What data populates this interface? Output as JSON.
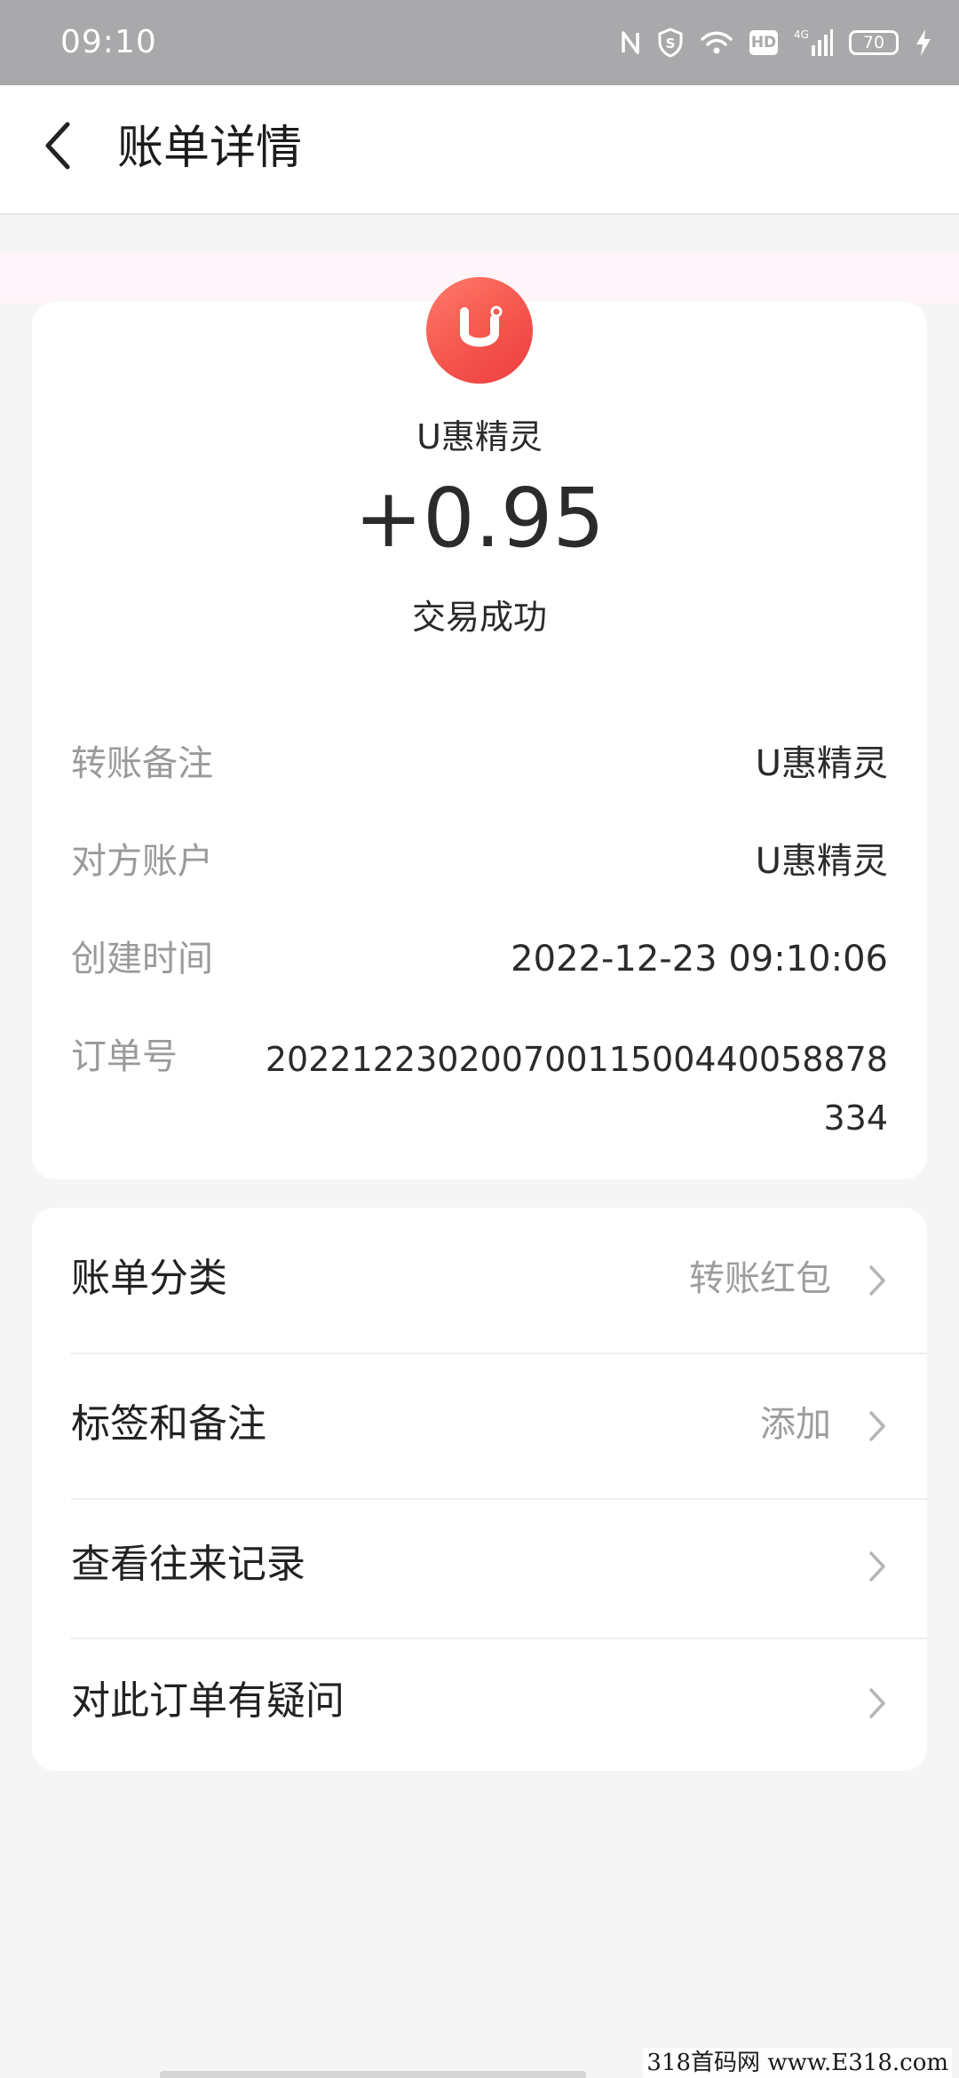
{
  "status_bar": {
    "time": "09:10",
    "icons": [
      "nfc-icon",
      "shield-icon",
      "wifi-icon",
      "hd-icon",
      "signal-4g-icon",
      "battery-icon",
      "charging-icon"
    ],
    "hd_label": "HD",
    "network_label": "4G",
    "battery_level": "70"
  },
  "header": {
    "back_icon": "chevron-left-icon",
    "title": "账单详情"
  },
  "transaction": {
    "logo_icon": "u-logo-icon",
    "merchant": "U惠精灵",
    "amount": "+0.95",
    "status": "交易成功",
    "details": [
      {
        "label": "转账备注",
        "value": "U惠精灵"
      },
      {
        "label": "对方账户",
        "value": "U惠精灵"
      },
      {
        "label": "创建时间",
        "value": "2022-12-23 09:10:06"
      },
      {
        "label": "订单号",
        "value": "20221223020070011500440058878334"
      }
    ]
  },
  "menu": {
    "items": [
      {
        "label": "账单分类",
        "value": "转账红包"
      },
      {
        "label": "标签和备注",
        "value": "添加"
      },
      {
        "label": "查看往来记录",
        "value": ""
      },
      {
        "label": "对此订单有疑问",
        "value": ""
      }
    ]
  },
  "watermark": "318首码网 www.E318.com",
  "colors": {
    "status_bar": "#a9a9ac",
    "background": "#f5f5f5",
    "logo": "#f4524a",
    "label_gray": "#9a9a9a"
  }
}
